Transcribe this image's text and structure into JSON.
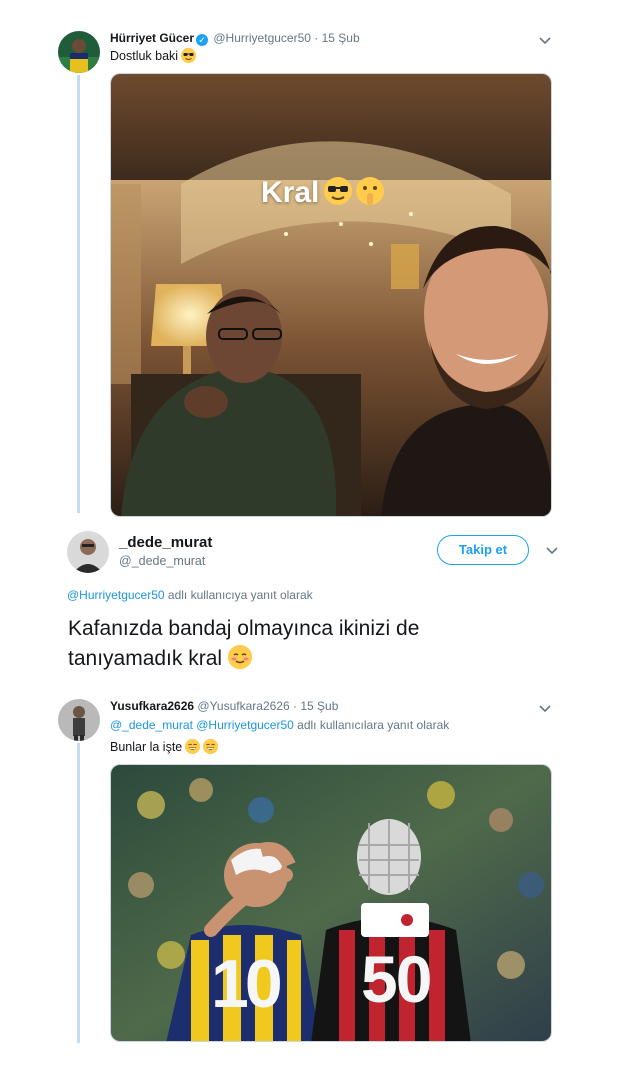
{
  "tweet1": {
    "name": "Hürriyet Gücer",
    "handle": "@Hurriyetgucer50",
    "separator": "·",
    "date": "15 Şub",
    "text": "Dostluk baki",
    "text_emoji": "sunglasses-emoji",
    "media_overlay": "Kral",
    "media_overlay_emojis": [
      "sunglasses-emoji",
      "shushing-face-emoji"
    ]
  },
  "tweet2": {
    "name": "_dede_murat",
    "handle": "@_dede_murat",
    "follow_label": "Takip et",
    "reply_mention": "@Hurriyetgucer50",
    "reply_suffix": "adlı kullanıcıya yanıt olarak",
    "text_line1": "Kafanızda bandaj olmayınca ikinizi de",
    "text_line2": "tanıyamadık kral",
    "text_emoji": "smiling-face-emoji"
  },
  "tweet3": {
    "name": "Yusufkara2626",
    "handle": "@Yusufkara2626",
    "separator": "·",
    "date": "15 Şub",
    "reply_mention1": "@_dede_murat",
    "reply_mention2": "@Hurriyetgucer50",
    "reply_suffix": "adlı kullanıcılara yanıt olarak",
    "text": "Bunlar la işte",
    "text_emojis": [
      "grinning-emoji",
      "grinning-emoji"
    ],
    "jersey_numbers": [
      "10",
      "50"
    ]
  },
  "colors": {
    "accent": "#1da1f2",
    "mention": "#1b95e0",
    "thread_line": "#c4dceb",
    "secondary_text": "#657786"
  }
}
